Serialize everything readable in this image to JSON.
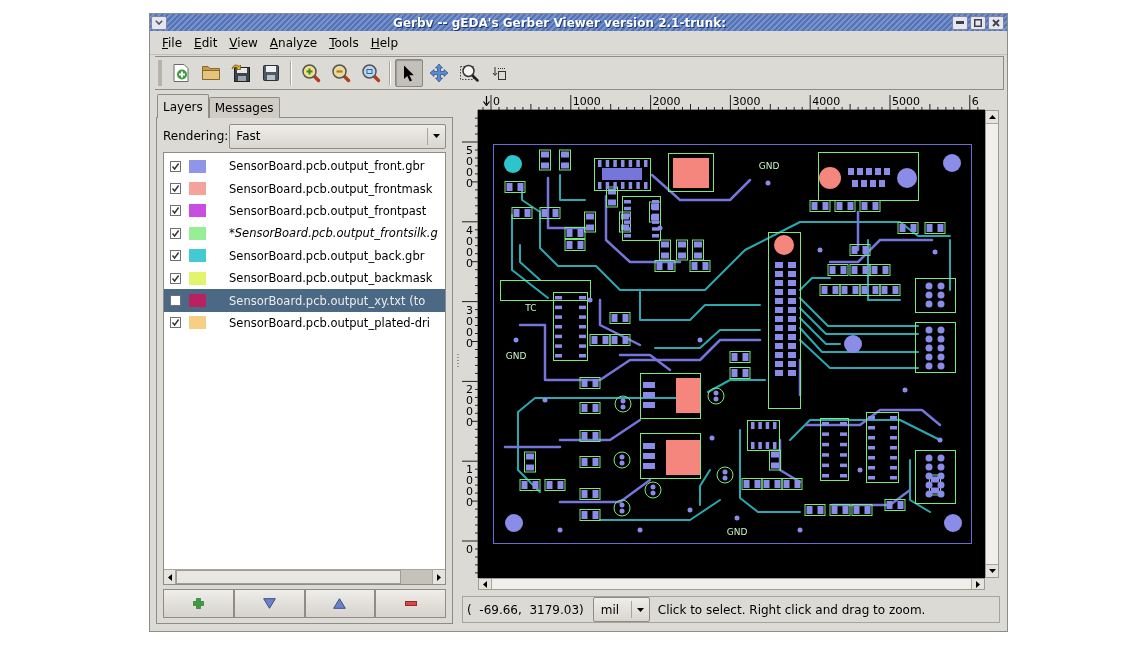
{
  "window": {
    "title": "Gerbv -- gEDA's Gerber Viewer version 2.1-trunk:"
  },
  "menu": [
    "File",
    "Edit",
    "View",
    "Analyze",
    "Tools",
    "Help"
  ],
  "toolbar": {
    "tools": [
      {
        "selected": true
      },
      {
        "selected": false
      },
      {
        "selected": false
      },
      {
        "selected": false
      }
    ]
  },
  "sidebar": {
    "tabs": [
      {
        "label": "Layers",
        "selected": true
      },
      {
        "label": "Messages",
        "selected": false
      }
    ],
    "rendering": {
      "label": "Rendering:",
      "value": "Fast"
    },
    "layers": [
      {
        "name": "SensorBoard.pcb.output_front.gbr",
        "visible": true,
        "color": "#8f95e8",
        "modified": false,
        "selected": false
      },
      {
        "name": "SensorBoard.pcb.output_frontmask",
        "visible": true,
        "color": "#f4a29b",
        "modified": false,
        "selected": false
      },
      {
        "name": "SensorBoard.pcb.output_frontpast",
        "visible": true,
        "color": "#c84ee2",
        "modified": false,
        "selected": false
      },
      {
        "name": "*SensorBoard.pcb.output_frontsilk.g",
        "visible": true,
        "color": "#96ee96",
        "modified": true,
        "selected": false
      },
      {
        "name": "SensorBoard.pcb.output_back.gbr",
        "visible": true,
        "color": "#42cbd3",
        "modified": false,
        "selected": false
      },
      {
        "name": "SensorBoard.pcb.output_backmask",
        "visible": true,
        "color": "#e3f46c",
        "modified": false,
        "selected": false
      },
      {
        "name": "SensorBoard.pcb.output_xy.txt (to",
        "visible": false,
        "color": "#b9225e",
        "modified": false,
        "selected": true
      },
      {
        "name": "SensorBoard.pcb.output_plated-dri",
        "visible": true,
        "color": "#f7cf84",
        "modified": false,
        "selected": false
      }
    ]
  },
  "rulers": {
    "horizontal": [
      "0",
      "1000",
      "2000",
      "3000",
      "4000",
      "5000",
      "6"
    ],
    "vertical": [
      "5000",
      "4000",
      "3000",
      "2000",
      "1000",
      "0"
    ]
  },
  "canvas": {
    "labels": [
      "GND",
      "TC",
      "GND",
      "GND"
    ]
  },
  "status_bar": {
    "coordinates": "(  -69.66,  3179.03)",
    "unit": "mil",
    "message": "Click to select. Right click and drag to zoom."
  }
}
